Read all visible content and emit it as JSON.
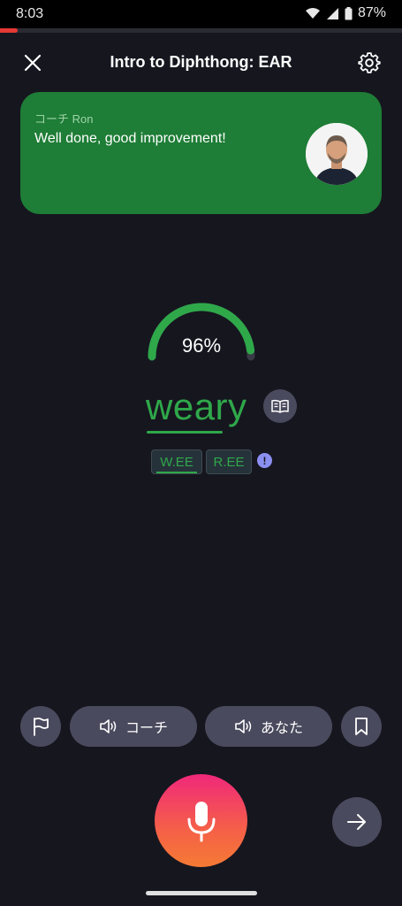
{
  "status_bar": {
    "time": "8:03",
    "battery": "87%"
  },
  "lesson_progress": 0.045,
  "header": {
    "title": "Intro to Diphthong: EAR"
  },
  "coach": {
    "name": "コーチ Ron",
    "message": "Well done, good improvement!"
  },
  "score": {
    "value": 96,
    "label": "96%"
  },
  "word": {
    "text": "weary"
  },
  "syllables": [
    {
      "text": "W.EE"
    },
    {
      "text": "R.EE"
    }
  ],
  "info_label": "!",
  "actions": {
    "coach_label": "コーチ",
    "you_label": "あなた"
  },
  "colors": {
    "accent_green": "#2fa84a",
    "coach_card": "#1e7d36",
    "progress": "#e53935",
    "button": "#4a4a5e",
    "mic_gradient_top": "#f0287a",
    "mic_gradient_bottom": "#f57a34"
  },
  "icons": {
    "close": "close-icon",
    "settings": "gear-icon",
    "dictionary": "book-icon",
    "flag": "flag-icon",
    "speaker": "speaker-icon",
    "bookmark": "bookmark-icon",
    "mic": "microphone-icon",
    "next": "arrow-right-icon"
  }
}
